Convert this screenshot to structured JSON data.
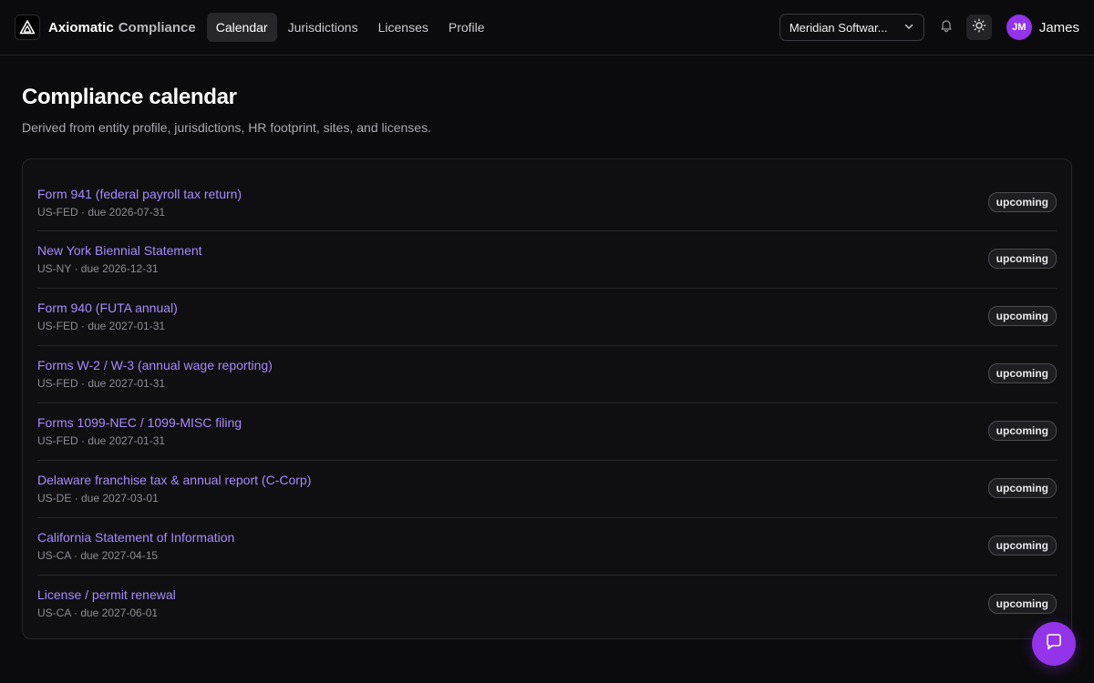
{
  "brand": {
    "name": "Axiomatic",
    "suffix": "Compliance"
  },
  "nav": {
    "items": [
      {
        "label": "Calendar",
        "active": true
      },
      {
        "label": "Jurisdictions",
        "active": false
      },
      {
        "label": "Licenses",
        "active": false
      },
      {
        "label": "Profile",
        "active": false
      }
    ]
  },
  "org_selector": {
    "value": "Meridian Softwar..."
  },
  "user": {
    "initials": "JM",
    "name": "James"
  },
  "page": {
    "title": "Compliance calendar",
    "subtitle": "Derived from entity profile, jurisdictions, HR footprint, sites, and licenses."
  },
  "calendar": {
    "items": [
      {
        "title": "Form 941 (federal payroll tax return)",
        "meta": "US-FED · due 2026-07-31",
        "status": "upcoming"
      },
      {
        "title": "New York Biennial Statement",
        "meta": "US-NY · due 2026-12-31",
        "status": "upcoming"
      },
      {
        "title": "Form 940 (FUTA annual)",
        "meta": "US-FED · due 2027-01-31",
        "status": "upcoming"
      },
      {
        "title": "Forms W-2 / W-3 (annual wage reporting)",
        "meta": "US-FED · due 2027-01-31",
        "status": "upcoming"
      },
      {
        "title": "Forms 1099-NEC / 1099-MISC filing",
        "meta": "US-FED · due 2027-01-31",
        "status": "upcoming"
      },
      {
        "title": "Delaware franchise tax & annual report (C-Corp)",
        "meta": "US-DE · due 2027-03-01",
        "status": "upcoming"
      },
      {
        "title": "California Statement of Information",
        "meta": "US-CA · due 2027-04-15",
        "status": "upcoming"
      },
      {
        "title": "License / permit renewal",
        "meta": "US-CA · due 2027-06-01",
        "status": "upcoming"
      }
    ]
  },
  "icons": {
    "logo": "triangle-logo-icon",
    "org_chevron": "chevron-down-icon",
    "notifications": "bell-icon",
    "theme": "sun-icon",
    "chat": "chat-bubble-icon"
  },
  "colors": {
    "accent": "#9333ea",
    "link": "#a78bfa",
    "background": "#0b0b0d"
  }
}
